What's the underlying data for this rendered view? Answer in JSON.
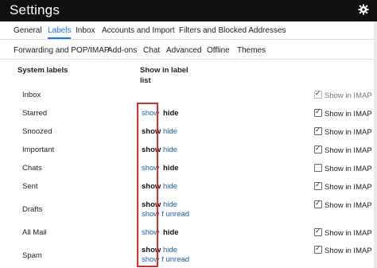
{
  "window": {
    "title": "Settings"
  },
  "tabs_row1": [
    "General",
    "Labels",
    "Inbox",
    "Accounts and Import",
    "Filters and Blocked Addresses"
  ],
  "tabs_row2": [
    "Forwarding and POP/IMAP",
    "Add-ons",
    "Chat",
    "Advanced",
    "Offline",
    "Themes"
  ],
  "active_tab": "Labels",
  "table": {
    "col1_header": "System labels",
    "col2_header_line1": "Show in label",
    "col2_header_line2": "list"
  },
  "rows": [
    {
      "label": "Inbox",
      "imap": "Show in IMAP"
    },
    {
      "label": "Starred",
      "show": "show",
      "hide": "hide",
      "imap": "Show in IMAP"
    },
    {
      "label": "Snoozed",
      "show": "show",
      "hide": "hide",
      "imap": "Show in IMAP"
    },
    {
      "label": "Important",
      "show": "show",
      "hide": "hide",
      "imap": "Show in IMAP"
    },
    {
      "label": "Chats",
      "show": "show",
      "hide": "hide",
      "imap": "Show in IMAP"
    },
    {
      "label": "Sent",
      "show": "show",
      "hide": "hide",
      "imap": "Show in IMAP"
    },
    {
      "label": "Drafts",
      "show": "show",
      "hide": "hide",
      "show2": "show",
      "unread": "f unread",
      "imap": "Show in IMAP"
    },
    {
      "label": "All Mail",
      "show": "show",
      "hide": "hide",
      "imap": "Show in IMAP"
    },
    {
      "label": "Spam",
      "show": "show",
      "hide": "hide",
      "show2": "show",
      "unread": "f unread",
      "imap": "Show in IMAP"
    }
  ],
  "colors": {
    "accent": "#1a73e8",
    "link": "#1a5fb4",
    "highlight_box": "#d32f2f",
    "titlebar": "#111111"
  }
}
